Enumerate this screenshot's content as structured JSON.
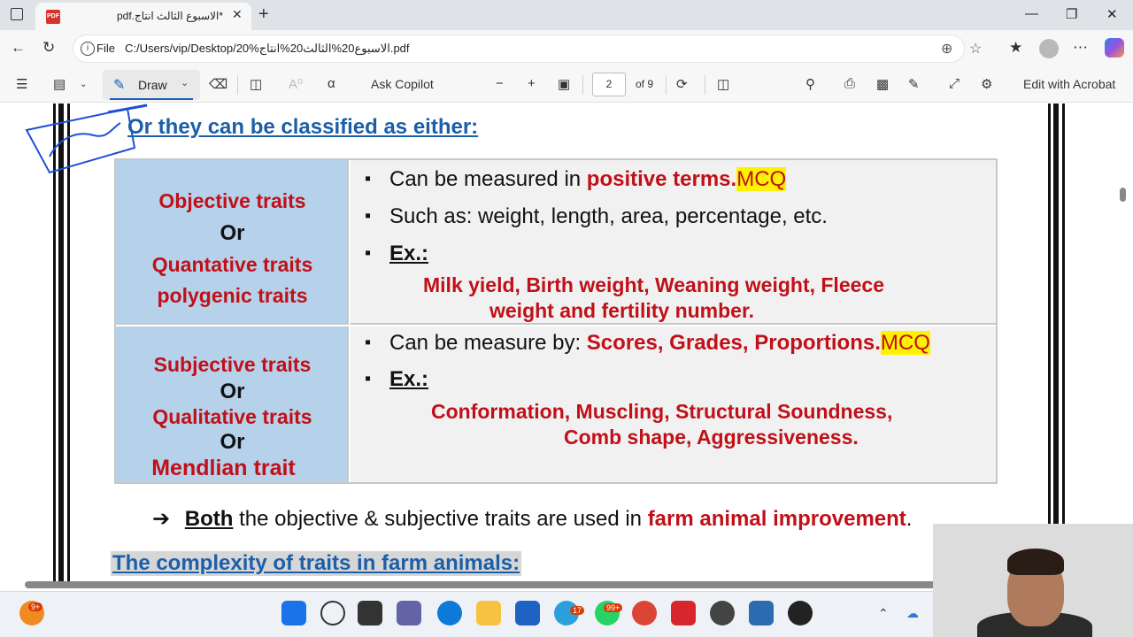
{
  "browser": {
    "tab_title": "pdf.الاسبوع الثالث انتاج*",
    "tab_close": "✕",
    "new_tab": "+",
    "address_prefix": "File",
    "address_url": "C:/Users/vip/Desktop/20%الاسبوع20%الثالث20%انتاج.pdf"
  },
  "toolbar": {
    "draw_label": "Draw",
    "ask_copilot": "Ask Copilot",
    "page_current": "2",
    "page_total": "of 9",
    "edit_with_acrobat": "Edit with Acrobat"
  },
  "document": {
    "heading": "Or they can be classified as either:",
    "rows": [
      {
        "left": [
          "Objective traits",
          "Or",
          "Quantative traits",
          "polygenic traits"
        ],
        "b1_pre": "Can be measured in ",
        "b1_red": "positive terms.",
        "b1_mcq": "MCQ",
        "b2": "Such as: weight, length, area, percentage, etc.",
        "ex_label": "Ex.:",
        "example_line1": "Milk yield, Birth weight, Weaning weight, Fleece",
        "example_line2": "weight  and fertility number."
      },
      {
        "left": [
          "Subjective traits",
          "Or",
          "Qualitative traits",
          "Or",
          "Mendlian trait"
        ],
        "b1_pre": "Can be measure by: ",
        "b1_red": "Scores, Grades, Proportions.",
        "b1_mcq": "MCQ",
        "ex_label": "Ex.:",
        "example_line1": "Conformation, Muscling, Structural Soundness,",
        "example_line2": "Comb shape, Aggressiveness."
      }
    ],
    "both_arrow": "➔",
    "both_bold": "Both",
    "both_text": " the objective & subjective traits are used in ",
    "both_red": "farm animal improvement",
    "both_end": ".",
    "complexity_heading": "The complexity of traits in farm animals:"
  },
  "taskbar": {
    "badge_left": "9+",
    "badge_mail": "99+",
    "badge_telegram": "17"
  },
  "colors": {
    "heading_blue": "#1d5fa7",
    "trait_red": "#c01018",
    "cell_blue": "#b6d1ea",
    "highlight_yellow": "#fff200"
  }
}
